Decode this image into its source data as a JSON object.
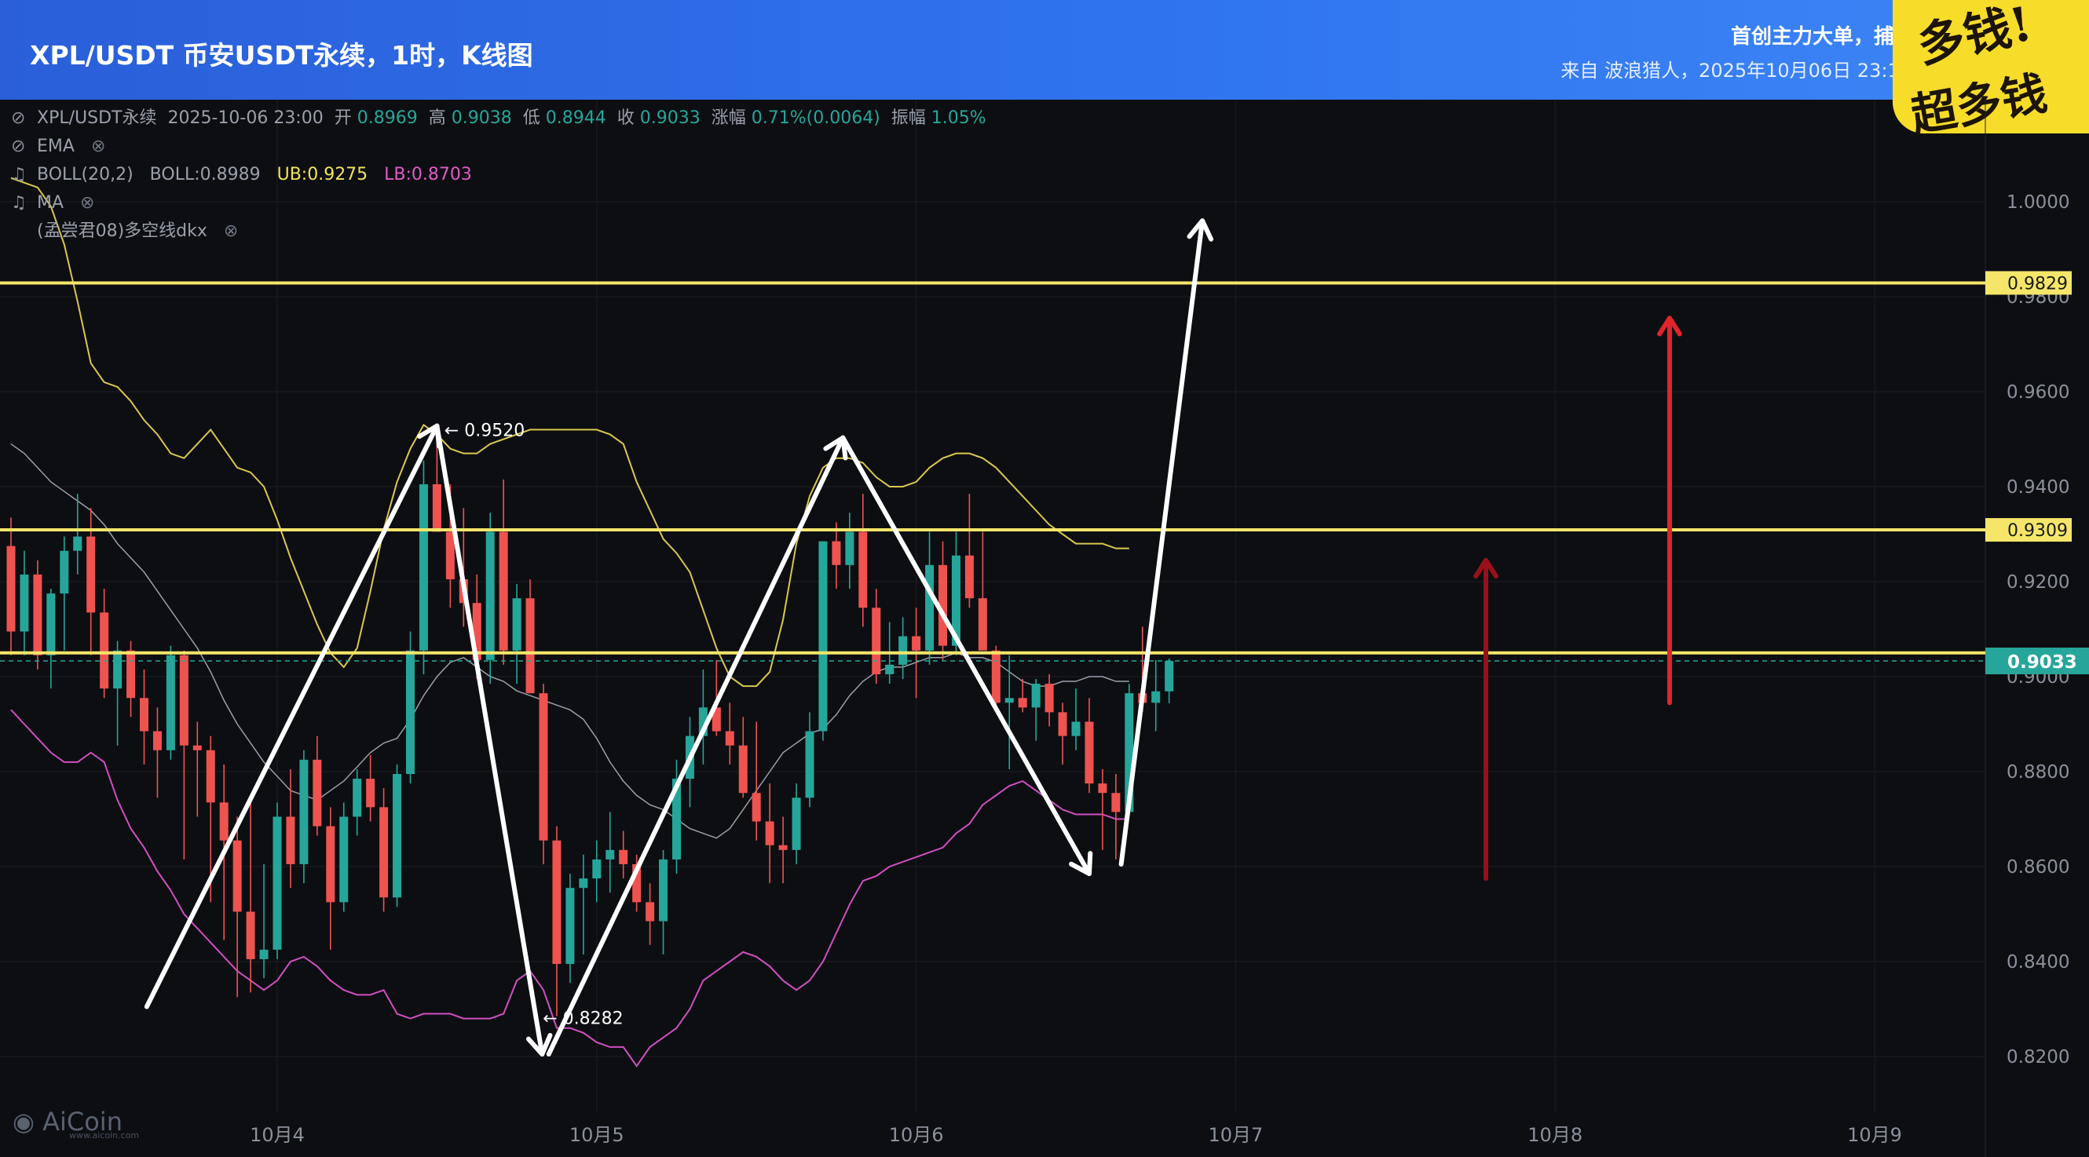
{
  "header": {
    "title": "XPL/USDT 币安USDT永续，1时，K线图",
    "slogan": "首创主力大单，捕获大",
    "source": "来自 波浪猎人，2025年10月06日 23:14"
  },
  "sticker": {
    "line1": "多钱!",
    "line2": "超多钱"
  },
  "legend": {
    "symbol": "XPL/USDT永续",
    "datetime": "2025-10-06 23:00",
    "open_label": "开",
    "open": "0.8969",
    "high_label": "高",
    "high": "0.9038",
    "low_label": "低",
    "low": "0.8944",
    "close_label": "收",
    "close": "0.9033",
    "change_label": "涨幅",
    "change": "0.71%(0.0064)",
    "amp_label": "振幅",
    "amp": "1.05%",
    "ema": "EMA",
    "boll": "BOLL(20,2)",
    "boll_mid": "BOLL:0.8989",
    "boll_ub": "UB:0.9275",
    "boll_lb": "LB:0.8703",
    "ma": "MA",
    "custom": "(孟尝君08)多空线dkx"
  },
  "watermark": {
    "brand": "AiCoin",
    "url": "www.aicoin.com"
  },
  "colors": {
    "up": "#26a69a",
    "down": "#ef5350",
    "level": "#f5e66a",
    "arrow": "#ffffff",
    "red_arrow": "#e0252b",
    "dark_red_arrow": "#9a1018",
    "price_tag": "#26a69a"
  },
  "chart_data": {
    "type": "candlestick",
    "title": "XPL/USDT 币安USDT永续，1时，K线图",
    "ylim": [
      0.8117,
      1.0124
    ],
    "y_ticks": [
      "1.0000",
      "0.9800",
      "0.9600",
      "0.9400",
      "0.9200",
      "0.9000",
      "0.8800",
      "0.8600",
      "0.8400",
      "0.8200"
    ],
    "x_ticks": [
      "10月4",
      "10月5",
      "10月6",
      "10月7",
      "10月8",
      "10月9"
    ],
    "x_tick_hours": [
      20,
      44,
      68,
      92,
      116,
      140
    ],
    "current_price": "0.9033",
    "levels": [
      "0.9829",
      "0.9309",
      "0.9050"
    ],
    "level_labels": [
      "0.9829",
      "0.9309",
      "0.9050"
    ],
    "annotations": [
      {
        "text": "0.9520",
        "hour": 32.2,
        "price": 0.952
      },
      {
        "text": "0.8282",
        "hour": 39.6,
        "price": 0.8282
      }
    ],
    "candles": [
      [
        0.9275,
        0.9335,
        0.9045,
        0.9095
      ],
      [
        0.9095,
        0.9265,
        0.9045,
        0.9215
      ],
      [
        0.9215,
        0.9245,
        0.9015,
        0.9045
      ],
      [
        0.9045,
        0.9185,
        0.8975,
        0.9175
      ],
      [
        0.9175,
        0.9295,
        0.9055,
        0.9265
      ],
      [
        0.9265,
        0.9385,
        0.9215,
        0.9295
      ],
      [
        0.9295,
        0.9355,
        0.9045,
        0.9135
      ],
      [
        0.9135,
        0.9185,
        0.8955,
        0.8975
      ],
      [
        0.8975,
        0.9075,
        0.8855,
        0.9055
      ],
      [
        0.9055,
        0.9075,
        0.8915,
        0.8955
      ],
      [
        0.8955,
        0.9015,
        0.8815,
        0.8885
      ],
      [
        0.8885,
        0.8935,
        0.8745,
        0.8845
      ],
      [
        0.8845,
        0.9065,
        0.8825,
        0.9045
      ],
      [
        0.9045,
        0.9055,
        0.8615,
        0.8855
      ],
      [
        0.8855,
        0.8905,
        0.8705,
        0.8845
      ],
      [
        0.8845,
        0.8875,
        0.8525,
        0.8735
      ],
      [
        0.8735,
        0.8815,
        0.8445,
        0.8655
      ],
      [
        0.8655,
        0.8705,
        0.8325,
        0.8505
      ],
      [
        0.8505,
        0.8735,
        0.8335,
        0.8405
      ],
      [
        0.8405,
        0.8605,
        0.8365,
        0.8425
      ],
      [
        0.8425,
        0.8735,
        0.8405,
        0.8705
      ],
      [
        0.8705,
        0.8805,
        0.8555,
        0.8605
      ],
      [
        0.8605,
        0.8845,
        0.8565,
        0.8825
      ],
      [
        0.8825,
        0.8875,
        0.8665,
        0.8685
      ],
      [
        0.8685,
        0.8725,
        0.8425,
        0.8525
      ],
      [
        0.8525,
        0.8735,
        0.8505,
        0.8705
      ],
      [
        0.8705,
        0.8805,
        0.8665,
        0.8785
      ],
      [
        0.8785,
        0.8835,
        0.8695,
        0.8725
      ],
      [
        0.8725,
        0.8765,
        0.8505,
        0.8535
      ],
      [
        0.8535,
        0.8815,
        0.8515,
        0.8795
      ],
      [
        0.8795,
        0.9095,
        0.8775,
        0.9055
      ],
      [
        0.9055,
        0.9455,
        0.9005,
        0.9405
      ],
      [
        0.9405,
        0.9525,
        0.9305,
        0.9305
      ],
      [
        0.9305,
        0.9405,
        0.9145,
        0.9205
      ],
      [
        0.9205,
        0.9355,
        0.9105,
        0.9155
      ],
      [
        0.9155,
        0.9215,
        0.8995,
        0.9035
      ],
      [
        0.9035,
        0.9345,
        0.8985,
        0.9305
      ],
      [
        0.9305,
        0.9415,
        0.9025,
        0.9055
      ],
      [
        0.9055,
        0.9195,
        0.8985,
        0.9165
      ],
      [
        0.9165,
        0.9205,
        0.8965,
        0.8965
      ],
      [
        0.8965,
        0.8985,
        0.8605,
        0.8655
      ],
      [
        0.8655,
        0.8685,
        0.8285,
        0.8395
      ],
      [
        0.8395,
        0.8585,
        0.8355,
        0.8555
      ],
      [
        0.8555,
        0.8625,
        0.8415,
        0.8575
      ],
      [
        0.8575,
        0.8655,
        0.8525,
        0.8615
      ],
      [
        0.8615,
        0.8715,
        0.8545,
        0.8635
      ],
      [
        0.8635,
        0.8675,
        0.8575,
        0.8605
      ],
      [
        0.8605,
        0.8625,
        0.8505,
        0.8525
      ],
      [
        0.8525,
        0.8565,
        0.8435,
        0.8485
      ],
      [
        0.8485,
        0.8635,
        0.8415,
        0.8615
      ],
      [
        0.8615,
        0.8825,
        0.8585,
        0.8785
      ],
      [
        0.8785,
        0.8915,
        0.8725,
        0.8875
      ],
      [
        0.8875,
        0.9015,
        0.8815,
        0.8935
      ],
      [
        0.8935,
        0.9035,
        0.8875,
        0.8885
      ],
      [
        0.8885,
        0.8945,
        0.8815,
        0.8855
      ],
      [
        0.8855,
        0.8915,
        0.8745,
        0.8755
      ],
      [
        0.8755,
        0.8905,
        0.8655,
        0.8695
      ],
      [
        0.8695,
        0.8775,
        0.8565,
        0.8645
      ],
      [
        0.8645,
        0.8705,
        0.8565,
        0.8635
      ],
      [
        0.8635,
        0.8775,
        0.8605,
        0.8745
      ],
      [
        0.8745,
        0.8925,
        0.8725,
        0.8885
      ],
      [
        0.8885,
        0.9245,
        0.8865,
        0.9285
      ],
      [
        0.9285,
        0.9325,
        0.9185,
        0.9235
      ],
      [
        0.9235,
        0.9345,
        0.9185,
        0.9305
      ],
      [
        0.9305,
        0.9385,
        0.9105,
        0.9145
      ],
      [
        0.9145,
        0.9185,
        0.8985,
        0.9005
      ],
      [
        0.9005,
        0.9115,
        0.8985,
        0.9025
      ],
      [
        0.9025,
        0.9125,
        0.8995,
        0.9085
      ],
      [
        0.9085,
        0.9145,
        0.8955,
        0.9055
      ],
      [
        0.9055,
        0.9305,
        0.9025,
        0.9235
      ],
      [
        0.9235,
        0.9285,
        0.9035,
        0.9065
      ],
      [
        0.9065,
        0.9305,
        0.9045,
        0.9255
      ],
      [
        0.9255,
        0.9385,
        0.9145,
        0.9165
      ],
      [
        0.9165,
        0.9305,
        0.9105,
        0.9055
      ],
      [
        0.9055,
        0.9065,
        0.8935,
        0.8945
      ],
      [
        0.8945,
        0.9045,
        0.8805,
        0.8955
      ],
      [
        0.8955,
        0.8995,
        0.8925,
        0.8935
      ],
      [
        0.8935,
        0.8995,
        0.8865,
        0.8985
      ],
      [
        0.8985,
        0.9005,
        0.8895,
        0.8925
      ],
      [
        0.8925,
        0.8945,
        0.8815,
        0.8875
      ],
      [
        0.8875,
        0.8975,
        0.8845,
        0.8905
      ],
      [
        0.8905,
        0.8955,
        0.8755,
        0.8775
      ],
      [
        0.8775,
        0.8805,
        0.8635,
        0.8755
      ],
      [
        0.8755,
        0.8795,
        0.8615,
        0.8715
      ],
      [
        0.8715,
        0.8985,
        0.8705,
        0.8965
      ],
      [
        0.8965,
        0.9105,
        0.8925,
        0.8945
      ],
      [
        0.8945,
        0.9035,
        0.8885,
        0.8969
      ],
      [
        0.8969,
        0.9038,
        0.8944,
        0.9033
      ]
    ],
    "boll_ub_series": [
      1.005,
      1.004,
      1.003,
      0.999,
      0.991,
      0.979,
      0.966,
      0.962,
      0.961,
      0.958,
      0.954,
      0.951,
      0.947,
      0.946,
      0.949,
      0.952,
      0.948,
      0.944,
      0.943,
      0.94,
      0.933,
      0.925,
      0.918,
      0.911,
      0.905,
      0.902,
      0.906,
      0.918,
      0.931,
      0.941,
      0.948,
      0.953,
      0.951,
      0.948,
      0.947,
      0.947,
      0.949,
      0.95,
      0.951,
      0.952,
      0.952,
      0.952,
      0.952,
      0.952,
      0.952,
      0.951,
      0.949,
      0.941,
      0.935,
      0.929,
      0.926,
      0.922,
      0.914,
      0.906,
      0.9,
      0.898,
      0.898,
      0.901,
      0.912,
      0.928,
      0.938,
      0.944,
      0.946,
      0.946,
      0.945,
      0.942,
      0.94,
      0.94,
      0.941,
      0.944,
      0.946,
      0.947,
      0.947,
      0.946,
      0.944,
      0.941,
      0.938,
      0.935,
      0.932,
      0.93,
      0.928,
      0.928,
      0.928,
      0.927,
      0.927
    ],
    "boll_mid_series": [
      0.949,
      0.947,
      0.944,
      0.941,
      0.939,
      0.937,
      0.935,
      0.932,
      0.928,
      0.925,
      0.922,
      0.918,
      0.914,
      0.91,
      0.906,
      0.901,
      0.895,
      0.89,
      0.886,
      0.882,
      0.879,
      0.876,
      0.875,
      0.874,
      0.876,
      0.878,
      0.881,
      0.884,
      0.886,
      0.887,
      0.891,
      0.896,
      0.9,
      0.903,
      0.904,
      0.902,
      0.9,
      0.899,
      0.897,
      0.896,
      0.895,
      0.894,
      0.893,
      0.891,
      0.887,
      0.882,
      0.878,
      0.875,
      0.873,
      0.872,
      0.87,
      0.868,
      0.867,
      0.866,
      0.868,
      0.872,
      0.876,
      0.88,
      0.884,
      0.886,
      0.888,
      0.889,
      0.892,
      0.896,
      0.899,
      0.901,
      0.902,
      0.902,
      0.903,
      0.904,
      0.904,
      0.905,
      0.904,
      0.904,
      0.903,
      0.901,
      0.899,
      0.898,
      0.898,
      0.899,
      0.899,
      0.9,
      0.9,
      0.899,
      0.899
    ],
    "boll_lb_series": [
      0.893,
      0.89,
      0.887,
      0.884,
      0.882,
      0.882,
      0.884,
      0.882,
      0.874,
      0.868,
      0.864,
      0.859,
      0.855,
      0.85,
      0.847,
      0.844,
      0.841,
      0.838,
      0.836,
      0.834,
      0.836,
      0.84,
      0.841,
      0.839,
      0.836,
      0.834,
      0.833,
      0.833,
      0.834,
      0.829,
      0.828,
      0.829,
      0.829,
      0.829,
      0.828,
      0.828,
      0.828,
      0.829,
      0.836,
      0.838,
      0.834,
      0.826,
      0.826,
      0.825,
      0.823,
      0.822,
      0.822,
      0.818,
      0.822,
      0.824,
      0.826,
      0.83,
      0.836,
      0.838,
      0.84,
      0.842,
      0.841,
      0.839,
      0.836,
      0.834,
      0.836,
      0.84,
      0.846,
      0.852,
      0.857,
      0.858,
      0.86,
      0.861,
      0.862,
      0.863,
      0.864,
      0.867,
      0.869,
      0.873,
      0.875,
      0.877,
      0.878,
      0.876,
      0.874,
      0.872,
      0.871,
      0.871,
      0.871,
      0.87,
      0.87
    ]
  }
}
